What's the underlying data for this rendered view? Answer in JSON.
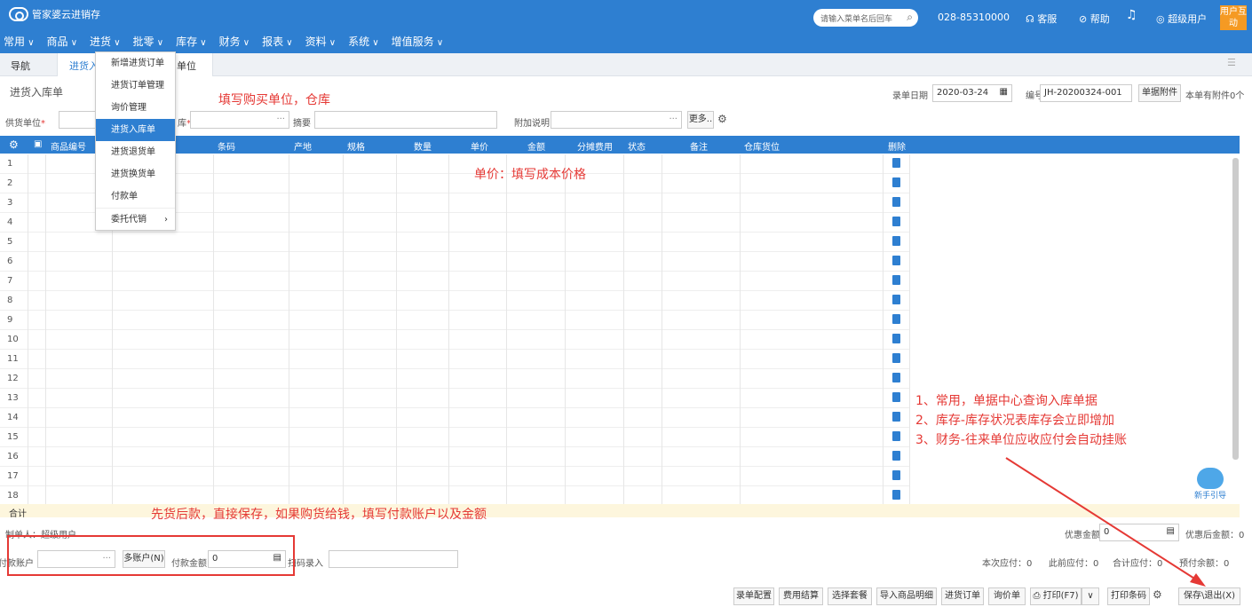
{
  "brand": {
    "title": "管家婆云进销存"
  },
  "top": {
    "search_placeholder": "请输入菜单名后回车",
    "phone": "028-85310000",
    "service": "客服",
    "help": "帮助",
    "user": "超级用户",
    "feedback": "用户互动"
  },
  "menu": [
    "常用",
    "商品",
    "进货",
    "批零",
    "库存",
    "财务",
    "报表",
    "资料",
    "系统",
    "增值服务"
  ],
  "tabs": {
    "nav": "导航",
    "active": "进货入",
    "partial": "单位"
  },
  "dropdown": [
    "新增进货订单",
    "进货订单管理",
    "询价管理",
    "进货入库单",
    "进货退货单",
    "进货换货单",
    "付款单",
    "委托代销"
  ],
  "form": {
    "title": "进货入库单",
    "date_label": "录单日期",
    "date_value": "2020-03-24",
    "no_label": "编号",
    "no_value": "JH-20200324-001",
    "attach_btn": "单据附件",
    "attach_info": "本单有附件0个",
    "supplier_label": "供货单位",
    "warehouse_label": "库",
    "summary_label": "摘要",
    "extra_label": "附加说明",
    "more_btn": "更多.."
  },
  "grid": {
    "headers": [
      "商品编号",
      "条码",
      "产地",
      "规格",
      "数量",
      "单价",
      "金额",
      "分摊费用",
      "状态",
      "备注",
      "仓库货位",
      "删除"
    ],
    "rows": [
      "1",
      "2",
      "3",
      "4",
      "5",
      "6",
      "7",
      "8",
      "9",
      "10",
      "11",
      "12",
      "13",
      "14",
      "15",
      "16",
      "17",
      "18"
    ],
    "sum_label": "合计"
  },
  "annotations": {
    "fill_unit": "填写购买单位，仓库",
    "unit_price": "单价：填写成本价格",
    "pay_first": "先货后款，直接保存，如果购货给钱，填写付款账户以及金额",
    "notes": [
      "1、常用，单据中心查询入库单据",
      "2、库存-库存状况表库存会立即增加",
      "3、财务-往来单位应收应付会自动挂账"
    ]
  },
  "footer": {
    "maker": "制单人：超级用户",
    "discount_label": "优惠金额",
    "discount_value": "0",
    "after_discount": "优惠后金额：0",
    "pay_account_label": "付款账户",
    "multi_account_btn": "多账户(N)",
    "pay_amount_label": "付款金额",
    "pay_amount_value": "0",
    "scan_label": "扫码录入",
    "this_due": "本次应付：0",
    "prev_due": "此前应付：0",
    "total_due": "合计应付：0",
    "prepaid": "预付余额：0",
    "buttons": [
      "录单配置",
      "费用结算",
      "选择套餐",
      "导入商品明细",
      "进货订单",
      "询价单",
      "打印(F7)",
      "打印条码",
      "保存\\退出(X)"
    ]
  },
  "guide": {
    "label": "新手引导"
  }
}
